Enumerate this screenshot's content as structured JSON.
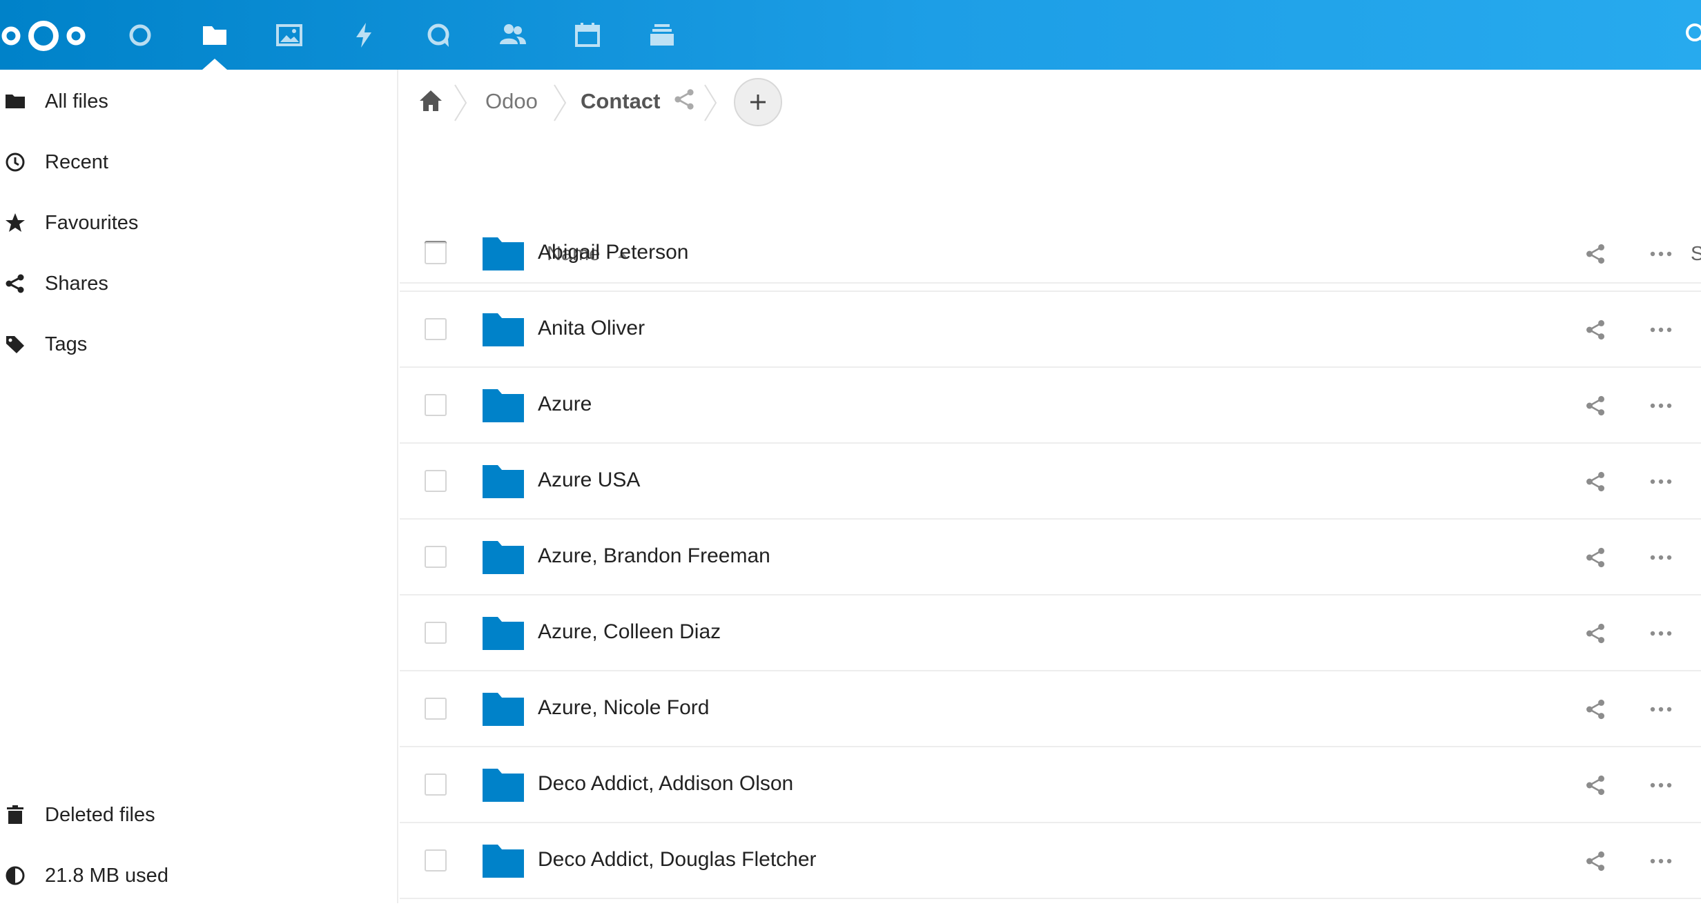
{
  "header": {
    "logo_icon": "nextcloud-logo",
    "apps": [
      {
        "name": "dashboard",
        "icon": "circle-icon"
      },
      {
        "name": "files",
        "icon": "folder-icon",
        "active": true
      },
      {
        "name": "photos",
        "icon": "image-icon"
      },
      {
        "name": "activity",
        "icon": "lightning-icon"
      },
      {
        "name": "talk",
        "icon": "chat-bubble-icon"
      },
      {
        "name": "contacts",
        "icon": "users-icon"
      },
      {
        "name": "calendar",
        "icon": "calendar-icon"
      },
      {
        "name": "deck",
        "icon": "stack-icon"
      }
    ],
    "search_icon": "search-icon",
    "accent_color": "#0082c9"
  },
  "sidebar": {
    "items": [
      {
        "label": "All files",
        "icon": "folder-icon"
      },
      {
        "label": "Recent",
        "icon": "clock-icon"
      },
      {
        "label": "Favourites",
        "icon": "star-icon"
      },
      {
        "label": "Shares",
        "icon": "share-icon"
      },
      {
        "label": "Tags",
        "icon": "tag-icon"
      }
    ],
    "bottom_items": [
      {
        "label": "Deleted files",
        "icon": "trash-icon"
      },
      {
        "label": "21.8 MB used",
        "icon": "quota-pie-icon"
      }
    ]
  },
  "breadcrumb": {
    "home_icon": "home-icon",
    "items": [
      "Odoo",
      "Contact"
    ]
  },
  "file_list": {
    "header": {
      "name": "Name",
      "size": "S"
    },
    "folder_color": "#0082c9",
    "rows": [
      {
        "name": "Abigail Peterson"
      },
      {
        "name": "Anita Oliver"
      },
      {
        "name": "Azure"
      },
      {
        "name": "Azure USA"
      },
      {
        "name": "Azure, Brandon Freeman"
      },
      {
        "name": "Azure, Colleen Diaz"
      },
      {
        "name": "Azure, Nicole Ford"
      },
      {
        "name": "Deco Addict, Addison Olson"
      },
      {
        "name": "Deco Addict, Douglas Fletcher"
      }
    ]
  }
}
